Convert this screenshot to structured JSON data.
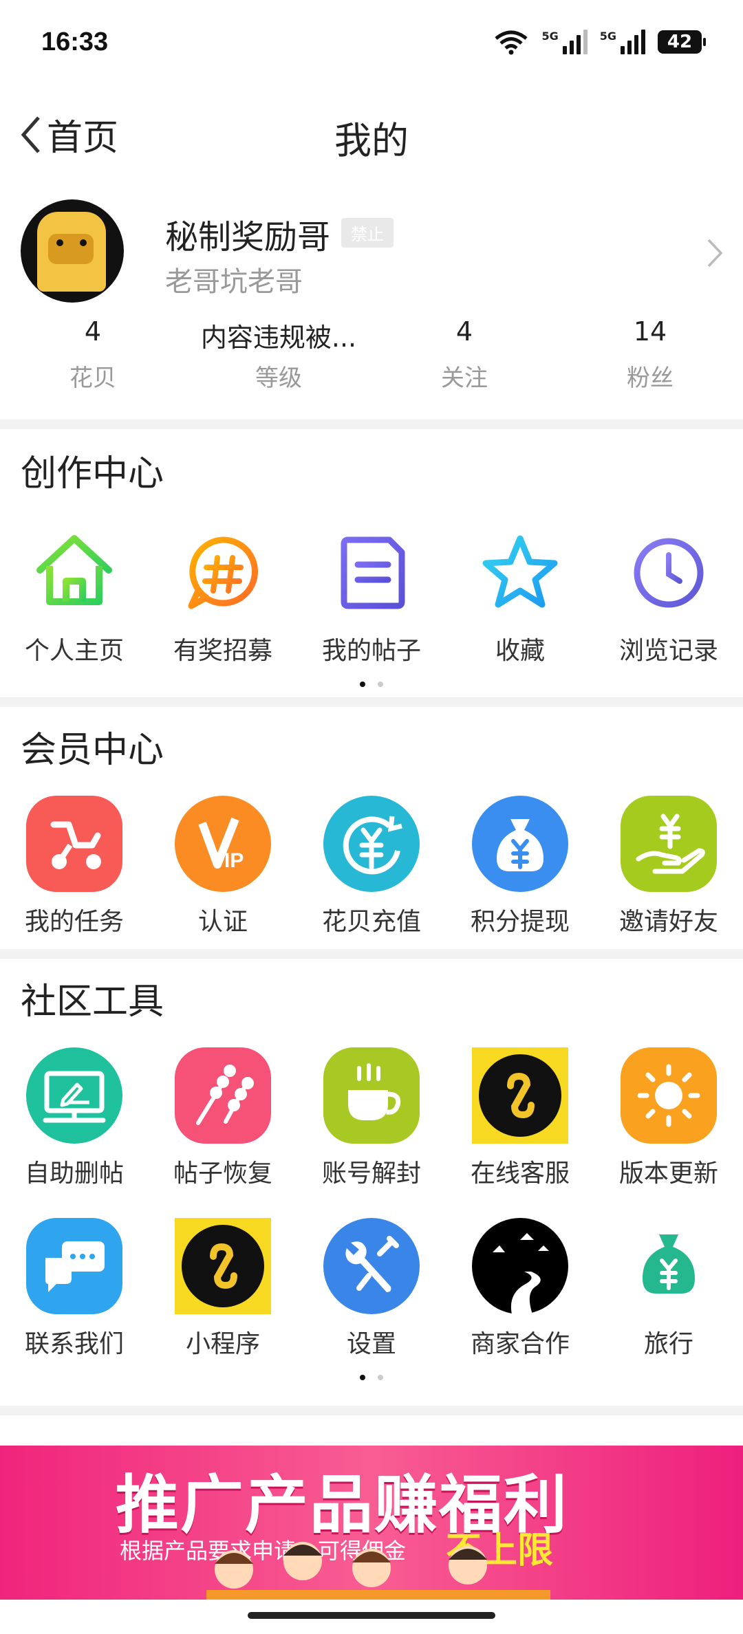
{
  "status_bar": {
    "time": "16:33",
    "network": "5G",
    "battery": "42"
  },
  "nav": {
    "back_label": "首页",
    "title": "我的"
  },
  "profile": {
    "username": "秘制奖励哥",
    "badge": "禁止",
    "signature": "老哥坑老哥"
  },
  "stats": [
    {
      "value": "4",
      "label": "花贝"
    },
    {
      "value": "内容违规被...",
      "label": "等级"
    },
    {
      "value": "4",
      "label": "关注"
    },
    {
      "value": "14",
      "label": "粉丝"
    }
  ],
  "creation_center": {
    "title": "创作中心",
    "items": [
      {
        "label": "个人主页",
        "icon": "home-icon"
      },
      {
        "label": "有奖招募",
        "icon": "hashtag-icon"
      },
      {
        "label": "我的帖子",
        "icon": "post-icon"
      },
      {
        "label": "收藏",
        "icon": "star-icon"
      },
      {
        "label": "浏览记录",
        "icon": "clock-icon"
      }
    ]
  },
  "member_center": {
    "title": "会员中心",
    "items": [
      {
        "label": "我的任务",
        "icon": "task-scooter-icon",
        "color": "#f85a55"
      },
      {
        "label": "认证",
        "icon": "vip-icon",
        "color": "#fb8c24"
      },
      {
        "label": "花贝充值",
        "icon": "recharge-icon",
        "color": "#27b8d6"
      },
      {
        "label": "积分提现",
        "icon": "money-bag-icon",
        "color": "#3a8ef0"
      },
      {
        "label": "邀请好友",
        "icon": "gift-hand-icon",
        "color": "#a6cb1f"
      }
    ]
  },
  "community_tools": {
    "title": "社区工具",
    "items": [
      {
        "label": "自助删帖",
        "icon": "monitor-edit-icon",
        "color": "#1fc19c"
      },
      {
        "label": "帖子恢复",
        "icon": "skewer-icon",
        "color": "#f65176"
      },
      {
        "label": "账号解封",
        "icon": "coffee-cup-icon",
        "color": "#a8c824"
      },
      {
        "label": "在线客服",
        "icon": "mini-program-icon",
        "color": "#f7d921"
      },
      {
        "label": "版本更新",
        "icon": "sun-icon",
        "color": "#fba120"
      },
      {
        "label": "联系我们",
        "icon": "chat-icon",
        "color": "#2ea5ee"
      },
      {
        "label": "小程序",
        "icon": "mini-program-icon",
        "color": "#f7d921"
      },
      {
        "label": "设置",
        "icon": "wrench-icon",
        "color": "#3a86e8"
      },
      {
        "label": "商家合作",
        "icon": "mountain-road-icon",
        "color": "#000000"
      },
      {
        "label": "旅行",
        "icon": "money-bag-icon",
        "color": "#25b88f"
      }
    ]
  },
  "banner": {
    "headline": "推广产品赚福利",
    "subline": "根据产品要求申请，可得佣金",
    "highlight": "不上限"
  }
}
